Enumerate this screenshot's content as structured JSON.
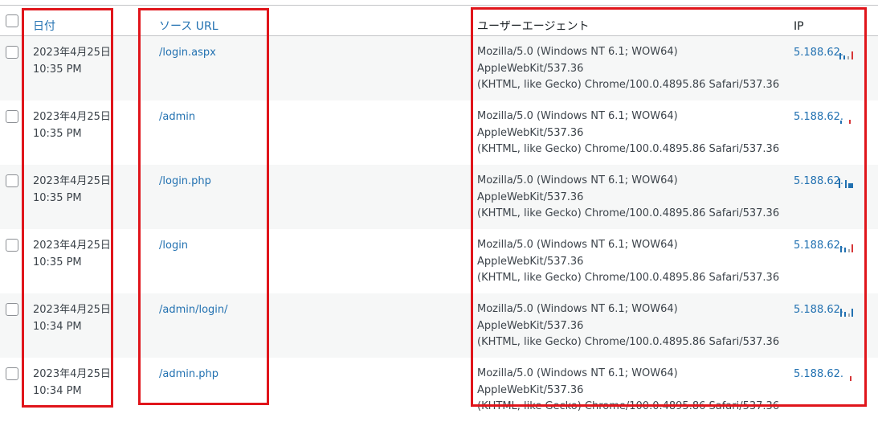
{
  "header": {
    "date": "日付",
    "source_url": "ソース URL",
    "user_agent": "ユーザーエージェント",
    "ip": "IP"
  },
  "rows": [
    {
      "date": "2023年4月25日",
      "time": "10:35 PM",
      "url": "/login.aspx",
      "ua1": "Mozilla/5.0 (Windows NT 6.1; WOW64) AppleWebKit/537.36",
      "ua2": "(KHTML, like Gecko) Chrome/100.0.4895.86 Safari/537.36",
      "ip": "5.188.62."
    },
    {
      "date": "2023年4月25日",
      "time": "10:35 PM",
      "url": "/admin",
      "ua1": "Mozilla/5.0 (Windows NT 6.1; WOW64) AppleWebKit/537.36",
      "ua2": "(KHTML, like Gecko) Chrome/100.0.4895.86 Safari/537.36",
      "ip": "5.188.62."
    },
    {
      "date": "2023年4月25日",
      "time": "10:35 PM",
      "url": "/login.php",
      "ua1": "Mozilla/5.0 (Windows NT 6.1; WOW64) AppleWebKit/537.36",
      "ua2": "(KHTML, like Gecko) Chrome/100.0.4895.86 Safari/537.36",
      "ip": "5.188.62."
    },
    {
      "date": "2023年4月25日",
      "time": "10:35 PM",
      "url": "/login",
      "ua1": "Mozilla/5.0 (Windows NT 6.1; WOW64) AppleWebKit/537.36",
      "ua2": "(KHTML, like Gecko) Chrome/100.0.4895.86 Safari/537.36",
      "ip": "5.188.62."
    },
    {
      "date": "2023年4月25日",
      "time": "10:34 PM",
      "url": "/admin/login/",
      "ua1": "Mozilla/5.0 (Windows NT 6.1; WOW64) AppleWebKit/537.36",
      "ua2": "(KHTML, like Gecko) Chrome/100.0.4895.86 Safari/537.36",
      "ip": "5.188.62."
    },
    {
      "date": "2023年4月25日",
      "time": "10:34 PM",
      "url": "/admin.php",
      "ua1": "Mozilla/5.0 (Windows NT 6.1; WOW64) AppleWebKit/537.36",
      "ua2": "(KHTML, like Gecko) Chrome/100.0.4895.86 Safari/537.36",
      "ip": "5.188.62."
    }
  ],
  "colors": {
    "link": "#2271b1",
    "highlight": "#e0151b",
    "row_alt": "#f6f7f7"
  }
}
